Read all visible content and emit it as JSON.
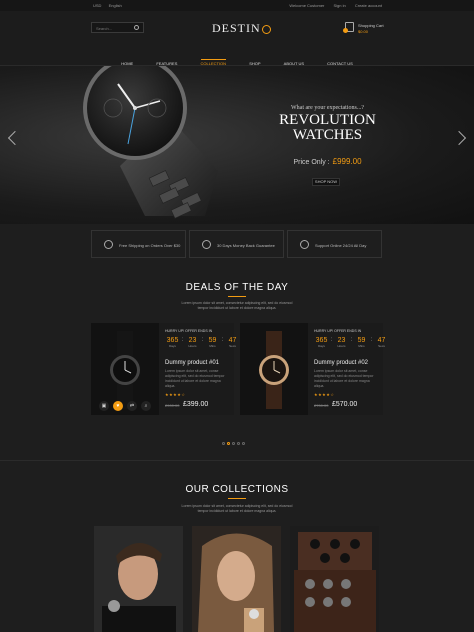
{
  "topbar": {
    "currency": "USD",
    "language": "English",
    "welcome": "Welcome Customer",
    "signin": "Sign in",
    "create": "Create account"
  },
  "header": {
    "search_placeholder": "Search...",
    "logo": "DESTIN",
    "cart_label": "Shopping Cart",
    "cart_total": "$0.00"
  },
  "nav": [
    "HOME",
    "FEATURES",
    "COLLECTION",
    "SHOP",
    "ABOUT US",
    "CONTACT US"
  ],
  "hero": {
    "subtitle": "What are your expectations...?",
    "title_line1": "REVOLUTION",
    "title_line2": "WATCHES",
    "price_label": "Price Only :",
    "price": "£999.00",
    "button": "SHOP NOW"
  },
  "features": [
    "Free Shipping on Orders Over $30",
    "30 Days Money Back Guarantee",
    "Support Online 24/24 All Day"
  ],
  "deals": {
    "title": "DEALS OF THE DAY",
    "description": "Lorem ipsum dolor sit amet, consectetur adipiscing elit, sed do eiusmod tempor incididunt ut labore et dolore magna aliqua.",
    "cards": [
      {
        "label": "HURRY UP! OFFER ENDS IN",
        "days": "365",
        "hours": "23",
        "mins": "59",
        "secs": "47",
        "u_days": "Days",
        "u_hours": "Hours",
        "u_mins": "Mins",
        "u_secs": "Secs",
        "name": "Dummy product #01",
        "desc": "Lorem ipsum dolor sit amet, conse adipiscing elit, sed do eiusmod tempor incididunt ut labore et dolore magna aliqua.",
        "stars": "★★★★☆",
        "old_price": "£900.00",
        "new_price": "£399.00"
      },
      {
        "label": "HURRY UP! OFFER ENDS IN",
        "days": "365",
        "hours": "23",
        "mins": "59",
        "secs": "47",
        "u_days": "Days",
        "u_hours": "Hours",
        "u_mins": "Mins",
        "u_secs": "Secs",
        "name": "Dummy product #02",
        "desc": "Lorem ipsum dolor sit amet, conse adipiscing elit, sed do eiusmod tempor incididunt ut labore et dolore magna aliqua.",
        "stars": "★★★★☆",
        "old_price": "£700.00",
        "new_price": "£570.00"
      }
    ]
  },
  "collections": {
    "title": "OUR COLLECTIONS",
    "description": "Lorem ipsum dolor sit amet, consectetur adipiscing elit, sed do eiusmod tempor incididunt ut labore et dolore magna aliqua."
  },
  "colors": {
    "accent": "#f39c12",
    "background": "#1e1e1e"
  }
}
